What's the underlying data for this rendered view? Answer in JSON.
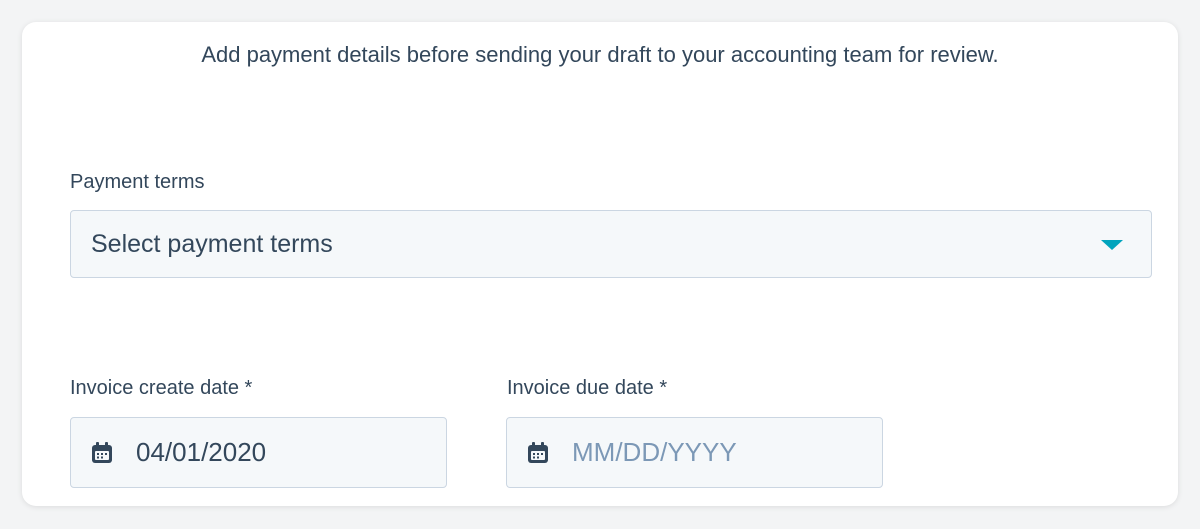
{
  "intro_text": "Add payment details before sending your draft to your accounting team for review.",
  "payment_terms": {
    "label": "Payment terms",
    "selected": "Select payment terms",
    "caret_color": "#00a4bd"
  },
  "create_date": {
    "label": "Invoice create date *",
    "value": "04/01/2020",
    "icon": "calendar-icon"
  },
  "due_date": {
    "label": "Invoice due date *",
    "placeholder": "MM/DD/YYYY",
    "icon": "calendar-icon"
  },
  "colors": {
    "text": "#33475b",
    "placeholder": "#7c98b6",
    "field_bg": "#f5f8fa",
    "field_border": "#cbd6e2",
    "accent": "#00a4bd"
  }
}
